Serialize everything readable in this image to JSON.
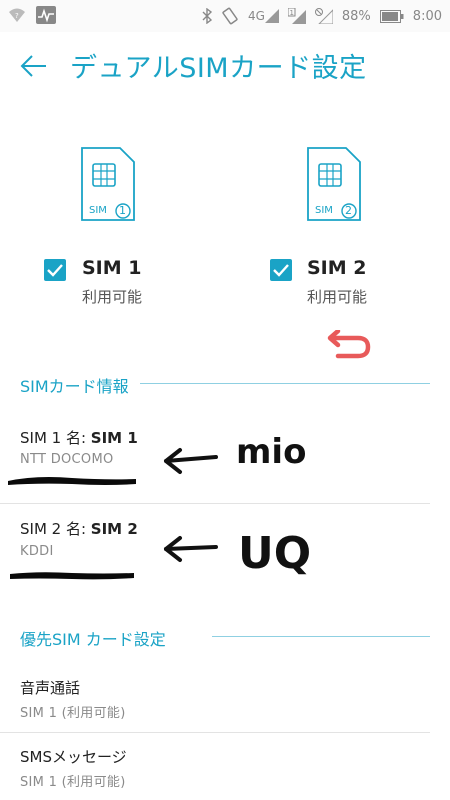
{
  "status_bar": {
    "icons_left": [
      "wifi-question-icon",
      "activity-icon"
    ],
    "icons_right": [
      "bluetooth-icon",
      "vibrate-icon",
      "signal-4g-icon",
      "signal-sim1-icon",
      "signal-no-sim-icon",
      "battery-icon"
    ],
    "network_label": "4G",
    "battery": "88%",
    "time": "8:00"
  },
  "header": {
    "title": "デュアルSIMカード設定"
  },
  "sims": [
    {
      "card_label": "SIM",
      "number": "1",
      "name": "SIM 1",
      "status": "利用可能",
      "checked": true
    },
    {
      "card_label": "SIM",
      "number": "2",
      "name": "SIM 2",
      "status": "利用可能",
      "checked": true
    }
  ],
  "sim_info_section": {
    "header": "SIMカード情報",
    "rows": [
      {
        "label_prefix": "SIM 1 名: ",
        "label_value": "SIM 1",
        "carrier": "NTT DOCOMO"
      },
      {
        "label_prefix": "SIM 2 名: ",
        "label_value": "SIM 2",
        "carrier": "KDDI"
      }
    ]
  },
  "preferred_section": {
    "header": "優先SIM カード設定",
    "rows": [
      {
        "title": "音声通話",
        "value": "SIM 1 (利用可能)"
      },
      {
        "title": "SMSメッセージ",
        "value": "SIM 1 (利用可能)"
      }
    ]
  },
  "annotations": {
    "mio": "mio",
    "uq": "UQ"
  },
  "colors": {
    "accent": "#1aa3c6",
    "undo_arrow": "#e85a5a"
  }
}
